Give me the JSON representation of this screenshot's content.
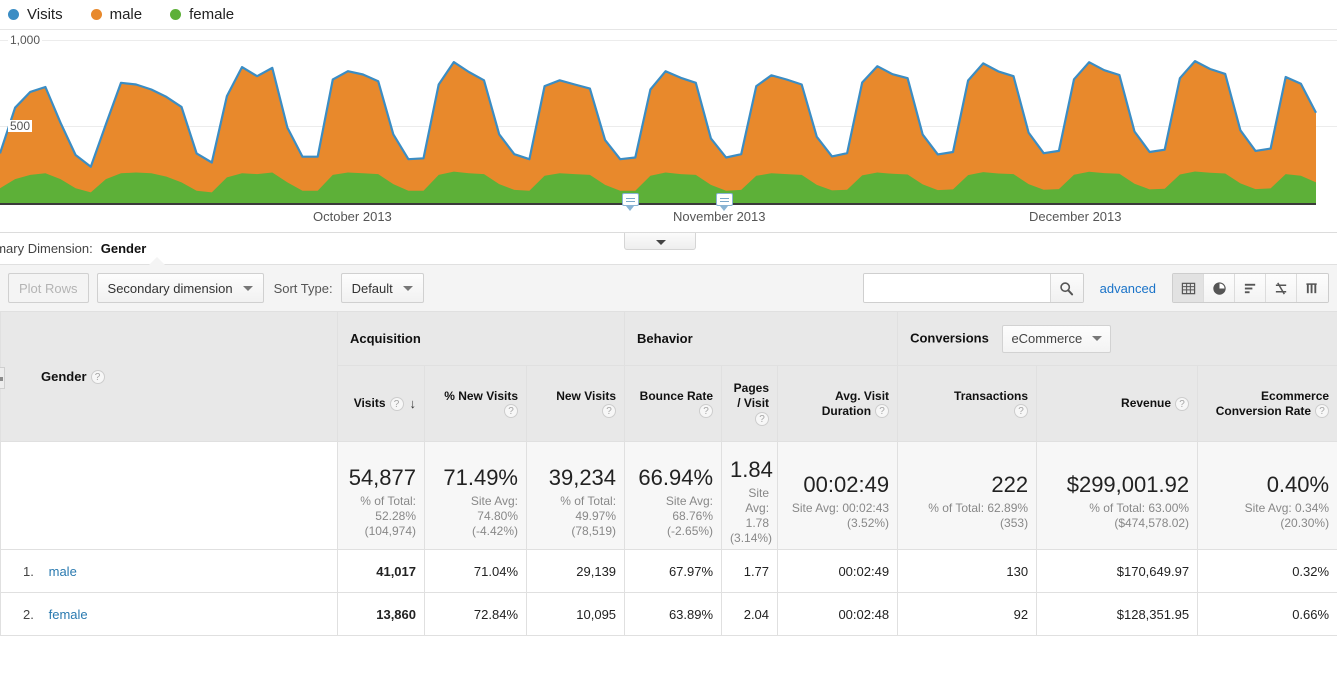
{
  "legend": {
    "items": [
      {
        "label": "Visits",
        "color": "#3b8dc4"
      },
      {
        "label": "male",
        "color": "#e8892c"
      },
      {
        "label": "female",
        "color": "#5db038"
      }
    ]
  },
  "chart_data": {
    "type": "area",
    "title": "",
    "xlabel": "",
    "ylabel": "",
    "ylim": [
      0,
      1000
    ],
    "ytick_labels": [
      "1,000",
      "500"
    ],
    "grid": true,
    "legend_position": "top-left",
    "x_tick_labels": [
      "October 2013",
      "November 2013",
      "December 2013"
    ],
    "annotations": [
      "annotation-marker",
      "annotation-marker"
    ],
    "series": [
      {
        "name": "male",
        "color": "#e8892c",
        "values": [
          210,
          430,
          500,
          520,
          340,
          200,
          155,
          330,
          545,
          530,
          505,
          480,
          455,
          225,
          180,
          490,
          640,
          590,
          630,
          330,
          205,
          205,
          575,
          610,
          595,
          560,
          300,
          190,
          195,
          545,
          660,
          610,
          565,
          300,
          215,
          190,
          540,
          560,
          540,
          520,
          270,
          190,
          200,
          520,
          610,
          580,
          555,
          280,
          200,
          215,
          540,
          590,
          570,
          545,
          290,
          205,
          220,
          560,
          640,
          600,
          580,
          300,
          215,
          225,
          570,
          655,
          615,
          590,
          310,
          220,
          230,
          575,
          660,
          620,
          595,
          315,
          225,
          235,
          580,
          665,
          625,
          600,
          320,
          230,
          240,
          585,
          555,
          420
        ]
      },
      {
        "name": "female",
        "color": "#5db038",
        "values": [
          95,
          150,
          175,
          185,
          150,
          95,
          70,
          150,
          185,
          190,
          185,
          165,
          130,
          80,
          70,
          160,
          185,
          180,
          190,
          130,
          80,
          80,
          175,
          190,
          185,
          180,
          120,
          80,
          80,
          175,
          195,
          185,
          180,
          120,
          85,
          80,
          170,
          185,
          180,
          175,
          115,
          80,
          80,
          170,
          190,
          180,
          175,
          115,
          80,
          85,
          170,
          185,
          180,
          175,
          115,
          82,
          86,
          172,
          190,
          182,
          178,
          118,
          84,
          88,
          174,
          192,
          184,
          180,
          120,
          86,
          90,
          176,
          194,
          186,
          182,
          122,
          88,
          92,
          178,
          196,
          188,
          184,
          124,
          90,
          94,
          180,
          170,
          130
        ]
      }
    ]
  },
  "primary_dimension": {
    "label": "rimary Dimension:",
    "value": "Gender"
  },
  "toolbar": {
    "plot_rows_label": "Plot Rows",
    "secondary_dimension_label": "Secondary dimension",
    "sort_type_label": "Sort Type:",
    "sort_type_value": "Default",
    "search_value": "",
    "search_placeholder": "",
    "advanced_label": "advanced",
    "view_icons": [
      {
        "name": "table-view-icon",
        "active": true
      },
      {
        "name": "percentage-view-icon",
        "active": false
      },
      {
        "name": "performance-view-icon",
        "active": false
      },
      {
        "name": "comparison-view-icon",
        "active": false
      },
      {
        "name": "pivot-view-icon",
        "active": false
      }
    ]
  },
  "table": {
    "groups": {
      "dimension": "Gender",
      "acquisition": "Acquisition",
      "behavior": "Behavior",
      "conversions": "Conversions",
      "conversions_select": "eCommerce"
    },
    "columns": [
      "Visits",
      "% New Visits",
      "New Visits",
      "Bounce Rate",
      "Pages / Visit",
      "Avg. Visit Duration",
      "Transactions",
      "Revenue",
      "Ecommerce Conversion Rate"
    ],
    "sort_indicator": "↓",
    "help_glyph": "?",
    "totals": [
      {
        "big": "54,877",
        "sub": "% of Total: 52.28% (104,974)"
      },
      {
        "big": "71.49%",
        "sub": "Site Avg: 74.80% (-4.42%)"
      },
      {
        "big": "39,234",
        "sub": "% of Total: 49.97% (78,519)"
      },
      {
        "big": "66.94%",
        "sub": "Site Avg: 68.76% (-2.65%)"
      },
      {
        "big": "1.84",
        "sub": "Site Avg: 1.78 (3.14%)"
      },
      {
        "big": "00:02:49",
        "sub": "Site Avg: 00:02:43 (3.52%)"
      },
      {
        "big": "222",
        "sub": "% of Total: 62.89% (353)"
      },
      {
        "big": "$299,001.92",
        "sub": "% of Total: 63.00% ($474,578.02)"
      },
      {
        "big": "0.40%",
        "sub": "Site Avg: 0.34% (20.30%)"
      }
    ],
    "rows": [
      {
        "rank": "1.",
        "dimension": "male",
        "values": [
          "41,017",
          "71.04%",
          "29,139",
          "67.97%",
          "1.77",
          "00:02:49",
          "130",
          "$170,649.97",
          "0.32%"
        ]
      },
      {
        "rank": "2.",
        "dimension": "female",
        "values": [
          "13,860",
          "72.84%",
          "10,095",
          "63.89%",
          "2.04",
          "00:02:48",
          "92",
          "$128,351.95",
          "0.66%"
        ]
      }
    ]
  }
}
